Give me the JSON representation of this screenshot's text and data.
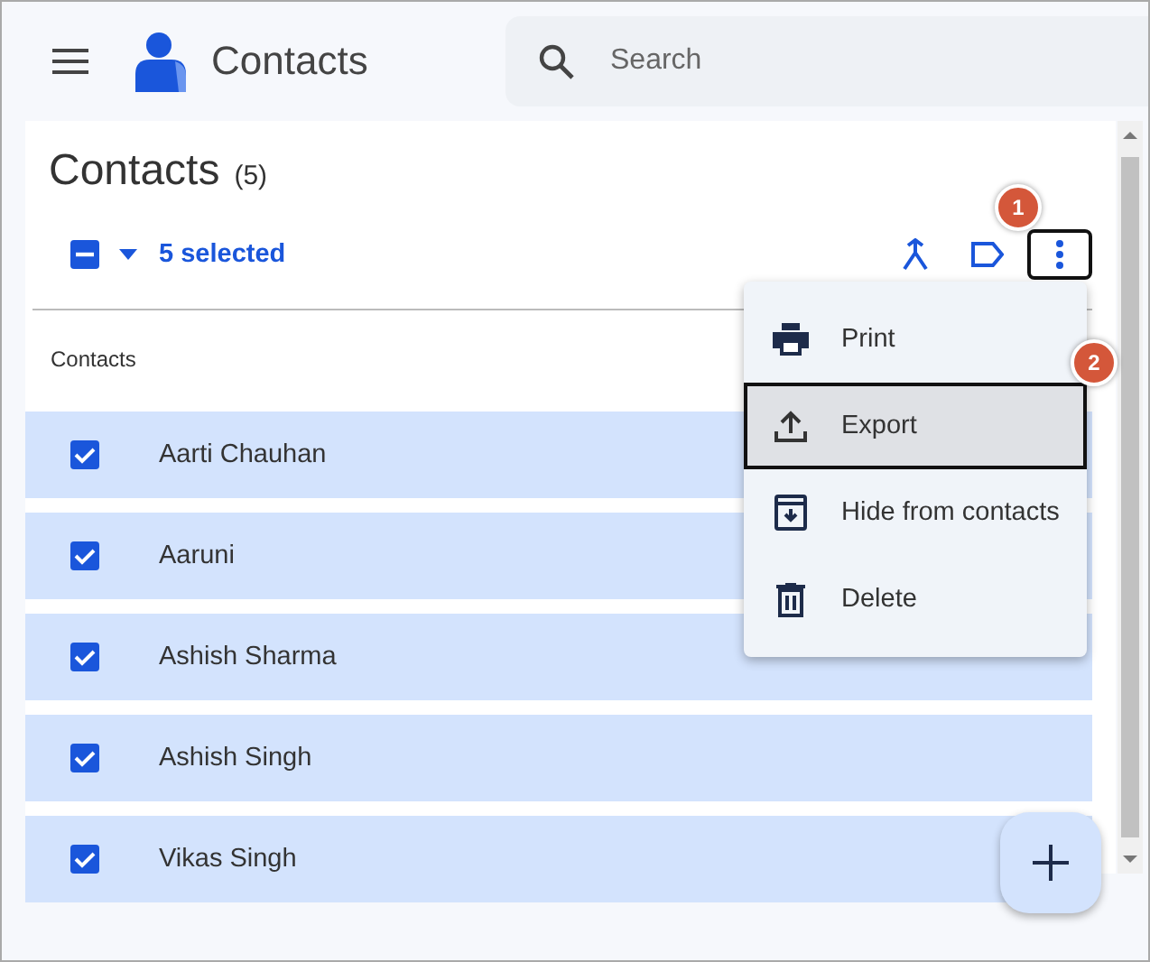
{
  "header": {
    "app_name": "Contacts",
    "search": {
      "placeholder": "Search"
    }
  },
  "page": {
    "title": "Contacts",
    "count": "(5)"
  },
  "toolbar": {
    "select_all_indeterminate": true,
    "selection_label": "5 selected",
    "actions": [
      {
        "kind": "merge",
        "highlighted": false
      },
      {
        "kind": "label",
        "highlighted": false
      },
      {
        "kind": "more",
        "highlighted": true
      }
    ]
  },
  "list": {
    "column_header": "Contacts",
    "rows": [
      {
        "name": "Aarti Chauhan",
        "checked": true
      },
      {
        "name": "Aaruni",
        "checked": true
      },
      {
        "name": "Ashish Sharma",
        "checked": true
      },
      {
        "name": "Ashish Singh",
        "checked": true
      },
      {
        "name": "Vikas Singh",
        "checked": true
      }
    ]
  },
  "menu": {
    "items": [
      {
        "kind": "print",
        "label": "Print",
        "highlighted": false
      },
      {
        "kind": "export",
        "label": "Export",
        "highlighted": true
      },
      {
        "kind": "hide",
        "label": "Hide from contacts",
        "highlighted": false
      },
      {
        "kind": "delete",
        "label": "Delete",
        "highlighted": false
      }
    ]
  },
  "annotations": [
    {
      "label": "1"
    },
    {
      "label": "2"
    }
  ]
}
